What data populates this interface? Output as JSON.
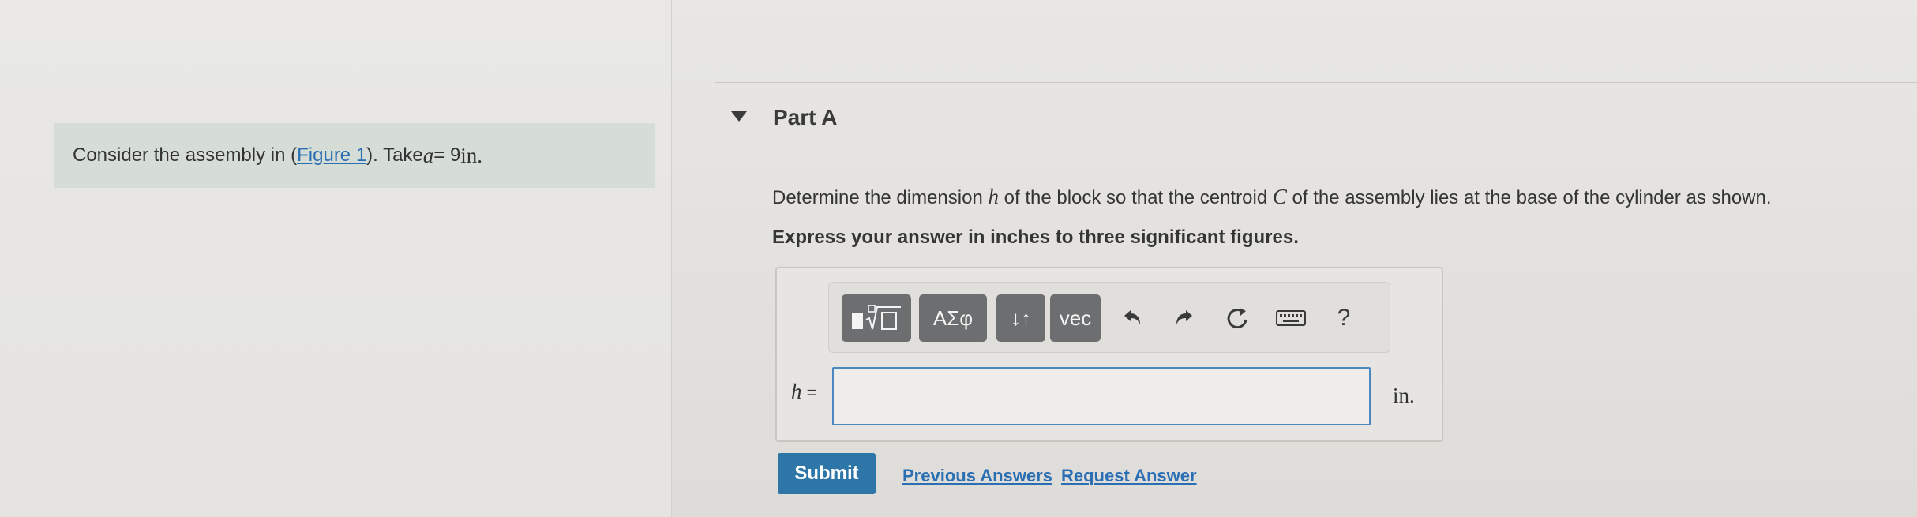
{
  "problem": {
    "prefix": "Consider the assembly in (",
    "figure_link": "Figure 1",
    "middle": "). Take ",
    "var": "a",
    "equals": " = 9 ",
    "unit": "in."
  },
  "part": {
    "title": "Part A"
  },
  "question": {
    "t1": "Determine the dimension ",
    "var_h": "h",
    "t2": " of the block so that the centroid ",
    "var_c": "C",
    "t3": " of the assembly lies at the base of the cylinder as shown."
  },
  "instruction": "Express your answer in inches to three significant figures.",
  "toolbar": {
    "greek_label": "ΑΣφ",
    "sort_label": "↓↑",
    "vec_label": "vec",
    "help_label": "?",
    "icons": [
      "templates-icon",
      "undo-icon",
      "redo-icon",
      "reset-icon",
      "keyboard-icon",
      "help-icon"
    ]
  },
  "answer": {
    "var_label": "h",
    "equals": " =",
    "value": "",
    "unit": "in."
  },
  "actions": {
    "submit": "Submit",
    "previous_answers": "Previous Answers",
    "request_answer": "Request Answer"
  },
  "colors": {
    "accent": "#2d76a7",
    "link": "#2a6fb3",
    "toolbar_button": "#6c6e70",
    "intro_background": "#d6ddd7",
    "input_border": "#4b87c2"
  }
}
